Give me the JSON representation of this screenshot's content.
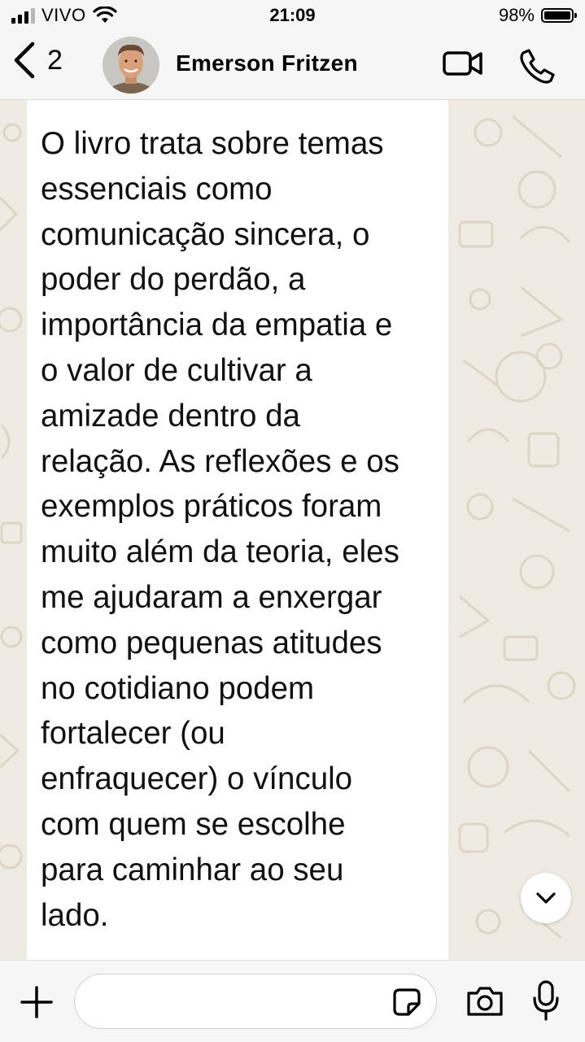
{
  "status_bar": {
    "carrier": "VIVO",
    "time": "21:09",
    "battery_percent": "98%",
    "battery_level": 0.98
  },
  "header": {
    "back_count": "2",
    "contact_name": "Emerson Fritzen",
    "icons": [
      "chevron-left-icon",
      "video-call-icon",
      "phone-icon"
    ]
  },
  "chat": {
    "message_lines": [
      "O livro trata sobre temas",
      "essenciais como",
      "comunicação sincera, o",
      "poder do perdão, a",
      "importância da empatia e",
      "o valor de cultivar a",
      "amizade dentro da",
      "relação. As reflexões e os",
      "exemplos práticos foram",
      "muito além da teoria, eles",
      "me ajudaram a enxergar",
      "como pequenas atitudes",
      "no cotidiano podem",
      "fortalecer (ou",
      "enfraquecer) o vínculo",
      "com quem se escolhe",
      "para caminhar ao seu",
      "lado."
    ]
  },
  "input_bar": {
    "message_value": "",
    "icons": [
      "plus-icon",
      "sticker-icon",
      "camera-icon",
      "microphone-icon"
    ]
  },
  "colors": {
    "bar_background": "#f6f6f6",
    "chat_background": "#efeae2",
    "bubble_background": "#ffffff",
    "icon_color": "#000000"
  }
}
